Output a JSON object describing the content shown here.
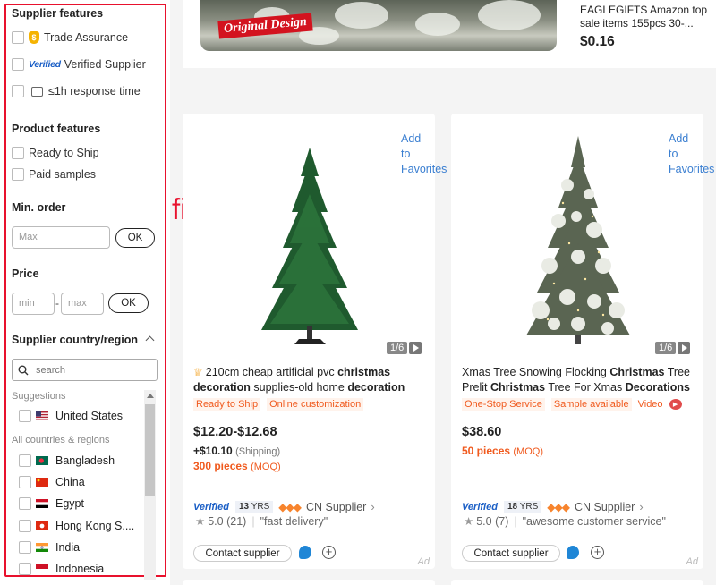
{
  "filters": {
    "supplier_features": {
      "title": "Supplier features",
      "items": [
        {
          "label": "Trade Assurance",
          "icon": "trade-assurance-shield-icon"
        },
        {
          "label": "Verified Supplier",
          "badge": "Verified",
          "icon": "verified-logo"
        },
        {
          "label": "≤1h response time",
          "icon": "chat-icon"
        }
      ]
    },
    "product_features": {
      "title": "Product features",
      "items": [
        "Ready to Ship",
        "Paid samples"
      ]
    },
    "min_order": {
      "title": "Min. order",
      "placeholder": "Max",
      "ok": "OK"
    },
    "price": {
      "title": "Price",
      "min_placeholder": "min",
      "dash": "-",
      "max_placeholder": "max",
      "ok": "OK"
    },
    "country": {
      "title": "Supplier country/region",
      "search_placeholder": "search",
      "suggestions_label": "Suggestions",
      "suggestions": [
        {
          "name": "United States",
          "flag": "us-flag"
        }
      ],
      "all_label": "All countries & regions",
      "countries": [
        {
          "name": "Bangladesh",
          "flag": "bangladesh-flag"
        },
        {
          "name": "China",
          "flag": "china-flag"
        },
        {
          "name": "Egypt",
          "flag": "egypt-flag"
        },
        {
          "name": "Hong Kong S....",
          "flag": "hong-kong-flag"
        },
        {
          "name": "India",
          "flag": "india-flag"
        },
        {
          "name": "Indonesia",
          "flag": "indonesia-flag"
        }
      ]
    }
  },
  "annotation": {
    "text": "filter",
    "color": "#e8112d"
  },
  "top_product": {
    "image_badge": "Original Design",
    "title": "EAGLEGIFTS Amazon top sale items 155pcs 30-...",
    "price": "$0.16"
  },
  "products": [
    {
      "add_favorites": [
        "Add",
        "to",
        "Favorites"
      ],
      "image_counter": "1/6",
      "title_parts": [
        {
          "text": "210cm cheap artificial pvc ",
          "bold": false
        },
        {
          "text": "christmas",
          "bold": true
        },
        {
          "text": " ",
          "bold": false
        },
        {
          "text": "decoration",
          "bold": true
        },
        {
          "text": " supplies-old home ",
          "bold": false
        },
        {
          "text": "decoration",
          "bold": true
        }
      ],
      "has_crown": true,
      "tags": [
        "Ready to Ship",
        "Online customization"
      ],
      "price": "$12.20-$12.68",
      "shipping": "+$10.10",
      "shipping_label": "(Shipping)",
      "moq": "300 pieces",
      "moq_label": "(MOQ)",
      "verified": "Verified",
      "years": "13",
      "years_label": "YRS",
      "country": "CN",
      "supplier_label": "Supplier",
      "rating": "5.0",
      "reviews": "(21)",
      "review_quote": "\"fast delivery\"",
      "contact": "Contact supplier",
      "ad": "Ad"
    },
    {
      "add_favorites": [
        "Add",
        "to",
        "Favorites"
      ],
      "image_counter": "1/6",
      "title_parts": [
        {
          "text": "Xmas Tree Snowing Flocking ",
          "bold": false
        },
        {
          "text": "Christmas",
          "bold": true
        },
        {
          "text": " Tree Prelit ",
          "bold": false
        },
        {
          "text": "Christmas",
          "bold": true
        },
        {
          "text": " Tree For Xmas ",
          "bold": false
        },
        {
          "text": "Decorations",
          "bold": true
        }
      ],
      "has_crown": false,
      "tags": [
        "One-Stop Service",
        "Sample available"
      ],
      "tag_extra": "Video",
      "price": "$38.60",
      "shipping": "",
      "moq": "50 pieces",
      "moq_label": "(MOQ)",
      "verified": "Verified",
      "years": "18",
      "years_label": "YRS",
      "country": "CN",
      "supplier_label": "Supplier",
      "rating": "5.0",
      "reviews": "(7)",
      "review_quote": "\"awesome customer service\"",
      "contact": "Contact supplier",
      "ad": "Ad"
    }
  ],
  "colors": {
    "accent_red": "#e8112d",
    "link_blue": "#3b7fd1",
    "orange": "#f05a1e",
    "verified_blue": "#1b5fc6"
  }
}
